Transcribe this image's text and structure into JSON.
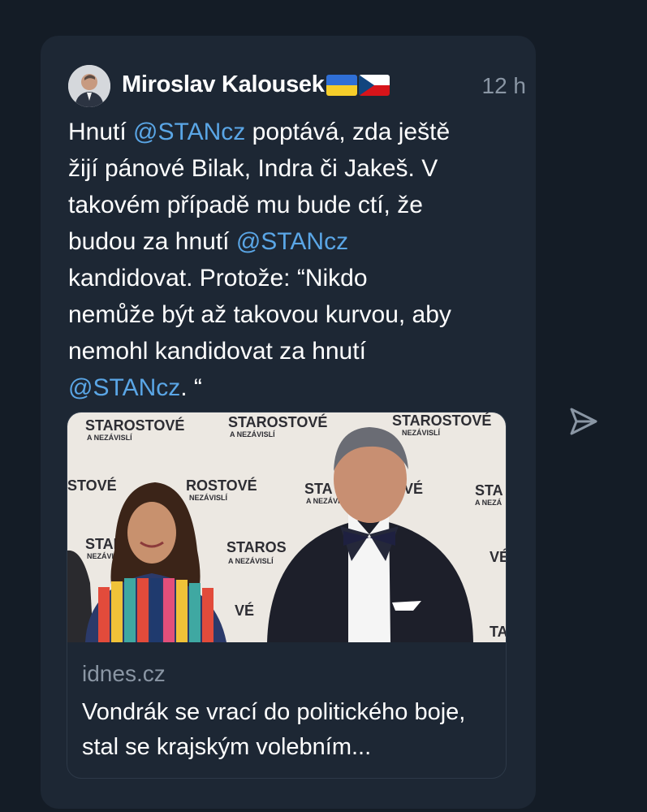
{
  "post": {
    "author": "Miroslav Kalousek",
    "time": "12 h",
    "text_parts": {
      "p1": "Hnutí ",
      "m1": "@STANcz",
      "p2": " poptává, zda ještě\nžijí pánové Bilak, Indra či Jakeš. V\ntakovém případě mu bude ctí, že\nbudou za hnutí ",
      "m2": "@STANcz",
      "p3": "\nkandidovat. Protože: “Nikdo\nnemůže být až takovou kurvou, aby\nnemohl kandidovat za hnutí\n",
      "m3": "@STANcz",
      "p4": ". “"
    }
  },
  "link_card": {
    "domain": "idnes.cz",
    "headline": "Vondrák se vrací do politického boje, stal se krajským volebním...",
    "backdrop_texts": {
      "t1": "STAROSTOVÉ",
      "t1s": "A NEZÁVISLÍ",
      "t2": "STAROSTOVÉ",
      "t2s": "A NEZÁVISLÍ",
      "t3": "STAROSTOVÉ",
      "t3s": "NEZÁVISLÍ",
      "t4": "STOVÉ",
      "t5": "ROSTOVÉ",
      "t5s": "NEZÁVISLÍ",
      "t6": "STA",
      "t6b": "VÉ",
      "t6s": "A NEZÁVISLÍ",
      "t7": "STA",
      "t7s": "A NEZÁ",
      "t8": "STAR",
      "t8s": "NEZÁVI",
      "t9": "STAROS",
      "t9s": "A NEZÁVISLÍ",
      "t10": "VÉ",
      "t11": "VÉ",
      "t12": "TA"
    }
  },
  "icons": {
    "send": "send-icon"
  },
  "colors": {
    "background": "#141c26",
    "card": "#1d2734",
    "mention": "#5aa6e6",
    "muted": "#8a96a4"
  }
}
